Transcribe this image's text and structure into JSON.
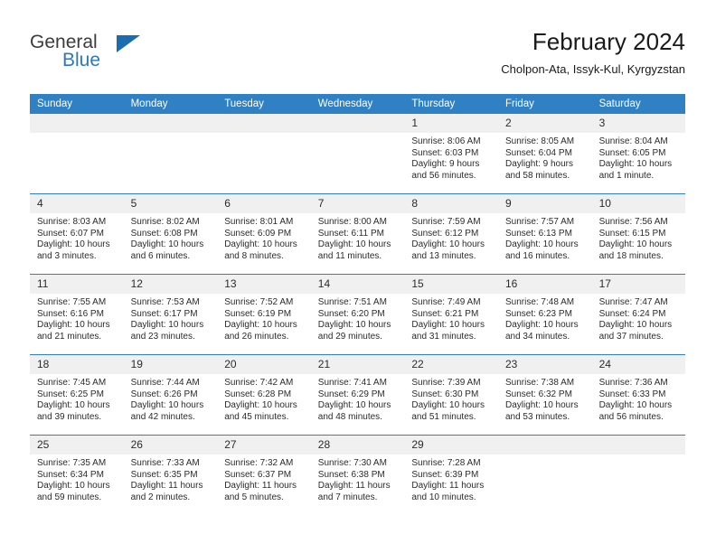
{
  "brand": {
    "logo_primary": "General",
    "logo_secondary": "Blue",
    "logo_triangle_color": "#1b6cb0",
    "logo_secondary_color": "#2a7ab9"
  },
  "header": {
    "title": "February 2024",
    "subtitle": "Cholpon-Ata, Issyk-Kul, Kyrgyzstan"
  },
  "theme": {
    "header_blue": "#3080c4",
    "daynum_background": "#f0f0f0",
    "text": "#2b2b2b"
  },
  "weekday_headers": [
    "Sunday",
    "Monday",
    "Tuesday",
    "Wednesday",
    "Thursday",
    "Friday",
    "Saturday"
  ],
  "weeks": [
    [
      {
        "day": "",
        "sunrise": "",
        "sunset": "",
        "daylight1": "",
        "daylight2": "",
        "blank": true
      },
      {
        "day": "",
        "sunrise": "",
        "sunset": "",
        "daylight1": "",
        "daylight2": "",
        "blank": true
      },
      {
        "day": "",
        "sunrise": "",
        "sunset": "",
        "daylight1": "",
        "daylight2": "",
        "blank": true
      },
      {
        "day": "",
        "sunrise": "",
        "sunset": "",
        "daylight1": "",
        "daylight2": "",
        "blank": true
      },
      {
        "day": "1",
        "sunrise": "Sunrise: 8:06 AM",
        "sunset": "Sunset: 6:03 PM",
        "daylight1": "Daylight: 9 hours",
        "daylight2": "and 56 minutes."
      },
      {
        "day": "2",
        "sunrise": "Sunrise: 8:05 AM",
        "sunset": "Sunset: 6:04 PM",
        "daylight1": "Daylight: 9 hours",
        "daylight2": "and 58 minutes."
      },
      {
        "day": "3",
        "sunrise": "Sunrise: 8:04 AM",
        "sunset": "Sunset: 6:05 PM",
        "daylight1": "Daylight: 10 hours",
        "daylight2": "and 1 minute."
      }
    ],
    [
      {
        "day": "4",
        "sunrise": "Sunrise: 8:03 AM",
        "sunset": "Sunset: 6:07 PM",
        "daylight1": "Daylight: 10 hours",
        "daylight2": "and 3 minutes."
      },
      {
        "day": "5",
        "sunrise": "Sunrise: 8:02 AM",
        "sunset": "Sunset: 6:08 PM",
        "daylight1": "Daylight: 10 hours",
        "daylight2": "and 6 minutes."
      },
      {
        "day": "6",
        "sunrise": "Sunrise: 8:01 AM",
        "sunset": "Sunset: 6:09 PM",
        "daylight1": "Daylight: 10 hours",
        "daylight2": "and 8 minutes."
      },
      {
        "day": "7",
        "sunrise": "Sunrise: 8:00 AM",
        "sunset": "Sunset: 6:11 PM",
        "daylight1": "Daylight: 10 hours",
        "daylight2": "and 11 minutes."
      },
      {
        "day": "8",
        "sunrise": "Sunrise: 7:59 AM",
        "sunset": "Sunset: 6:12 PM",
        "daylight1": "Daylight: 10 hours",
        "daylight2": "and 13 minutes."
      },
      {
        "day": "9",
        "sunrise": "Sunrise: 7:57 AM",
        "sunset": "Sunset: 6:13 PM",
        "daylight1": "Daylight: 10 hours",
        "daylight2": "and 16 minutes."
      },
      {
        "day": "10",
        "sunrise": "Sunrise: 7:56 AM",
        "sunset": "Sunset: 6:15 PM",
        "daylight1": "Daylight: 10 hours",
        "daylight2": "and 18 minutes."
      }
    ],
    [
      {
        "day": "11",
        "sunrise": "Sunrise: 7:55 AM",
        "sunset": "Sunset: 6:16 PM",
        "daylight1": "Daylight: 10 hours",
        "daylight2": "and 21 minutes."
      },
      {
        "day": "12",
        "sunrise": "Sunrise: 7:53 AM",
        "sunset": "Sunset: 6:17 PM",
        "daylight1": "Daylight: 10 hours",
        "daylight2": "and 23 minutes."
      },
      {
        "day": "13",
        "sunrise": "Sunrise: 7:52 AM",
        "sunset": "Sunset: 6:19 PM",
        "daylight1": "Daylight: 10 hours",
        "daylight2": "and 26 minutes."
      },
      {
        "day": "14",
        "sunrise": "Sunrise: 7:51 AM",
        "sunset": "Sunset: 6:20 PM",
        "daylight1": "Daylight: 10 hours",
        "daylight2": "and 29 minutes."
      },
      {
        "day": "15",
        "sunrise": "Sunrise: 7:49 AM",
        "sunset": "Sunset: 6:21 PM",
        "daylight1": "Daylight: 10 hours",
        "daylight2": "and 31 minutes."
      },
      {
        "day": "16",
        "sunrise": "Sunrise: 7:48 AM",
        "sunset": "Sunset: 6:23 PM",
        "daylight1": "Daylight: 10 hours",
        "daylight2": "and 34 minutes."
      },
      {
        "day": "17",
        "sunrise": "Sunrise: 7:47 AM",
        "sunset": "Sunset: 6:24 PM",
        "daylight1": "Daylight: 10 hours",
        "daylight2": "and 37 minutes."
      }
    ],
    [
      {
        "day": "18",
        "sunrise": "Sunrise: 7:45 AM",
        "sunset": "Sunset: 6:25 PM",
        "daylight1": "Daylight: 10 hours",
        "daylight2": "and 39 minutes."
      },
      {
        "day": "19",
        "sunrise": "Sunrise: 7:44 AM",
        "sunset": "Sunset: 6:26 PM",
        "daylight1": "Daylight: 10 hours",
        "daylight2": "and 42 minutes."
      },
      {
        "day": "20",
        "sunrise": "Sunrise: 7:42 AM",
        "sunset": "Sunset: 6:28 PM",
        "daylight1": "Daylight: 10 hours",
        "daylight2": "and 45 minutes."
      },
      {
        "day": "21",
        "sunrise": "Sunrise: 7:41 AM",
        "sunset": "Sunset: 6:29 PM",
        "daylight1": "Daylight: 10 hours",
        "daylight2": "and 48 minutes."
      },
      {
        "day": "22",
        "sunrise": "Sunrise: 7:39 AM",
        "sunset": "Sunset: 6:30 PM",
        "daylight1": "Daylight: 10 hours",
        "daylight2": "and 51 minutes."
      },
      {
        "day": "23",
        "sunrise": "Sunrise: 7:38 AM",
        "sunset": "Sunset: 6:32 PM",
        "daylight1": "Daylight: 10 hours",
        "daylight2": "and 53 minutes."
      },
      {
        "day": "24",
        "sunrise": "Sunrise: 7:36 AM",
        "sunset": "Sunset: 6:33 PM",
        "daylight1": "Daylight: 10 hours",
        "daylight2": "and 56 minutes."
      }
    ],
    [
      {
        "day": "25",
        "sunrise": "Sunrise: 7:35 AM",
        "sunset": "Sunset: 6:34 PM",
        "daylight1": "Daylight: 10 hours",
        "daylight2": "and 59 minutes."
      },
      {
        "day": "26",
        "sunrise": "Sunrise: 7:33 AM",
        "sunset": "Sunset: 6:35 PM",
        "daylight1": "Daylight: 11 hours",
        "daylight2": "and 2 minutes."
      },
      {
        "day": "27",
        "sunrise": "Sunrise: 7:32 AM",
        "sunset": "Sunset: 6:37 PM",
        "daylight1": "Daylight: 11 hours",
        "daylight2": "and 5 minutes."
      },
      {
        "day": "28",
        "sunrise": "Sunrise: 7:30 AM",
        "sunset": "Sunset: 6:38 PM",
        "daylight1": "Daylight: 11 hours",
        "daylight2": "and 7 minutes."
      },
      {
        "day": "29",
        "sunrise": "Sunrise: 7:28 AM",
        "sunset": "Sunset: 6:39 PM",
        "daylight1": "Daylight: 11 hours",
        "daylight2": "and 10 minutes."
      },
      {
        "day": "",
        "sunrise": "",
        "sunset": "",
        "daylight1": "",
        "daylight2": "",
        "blank": true
      },
      {
        "day": "",
        "sunrise": "",
        "sunset": "",
        "daylight1": "",
        "daylight2": "",
        "blank": true
      }
    ]
  ]
}
